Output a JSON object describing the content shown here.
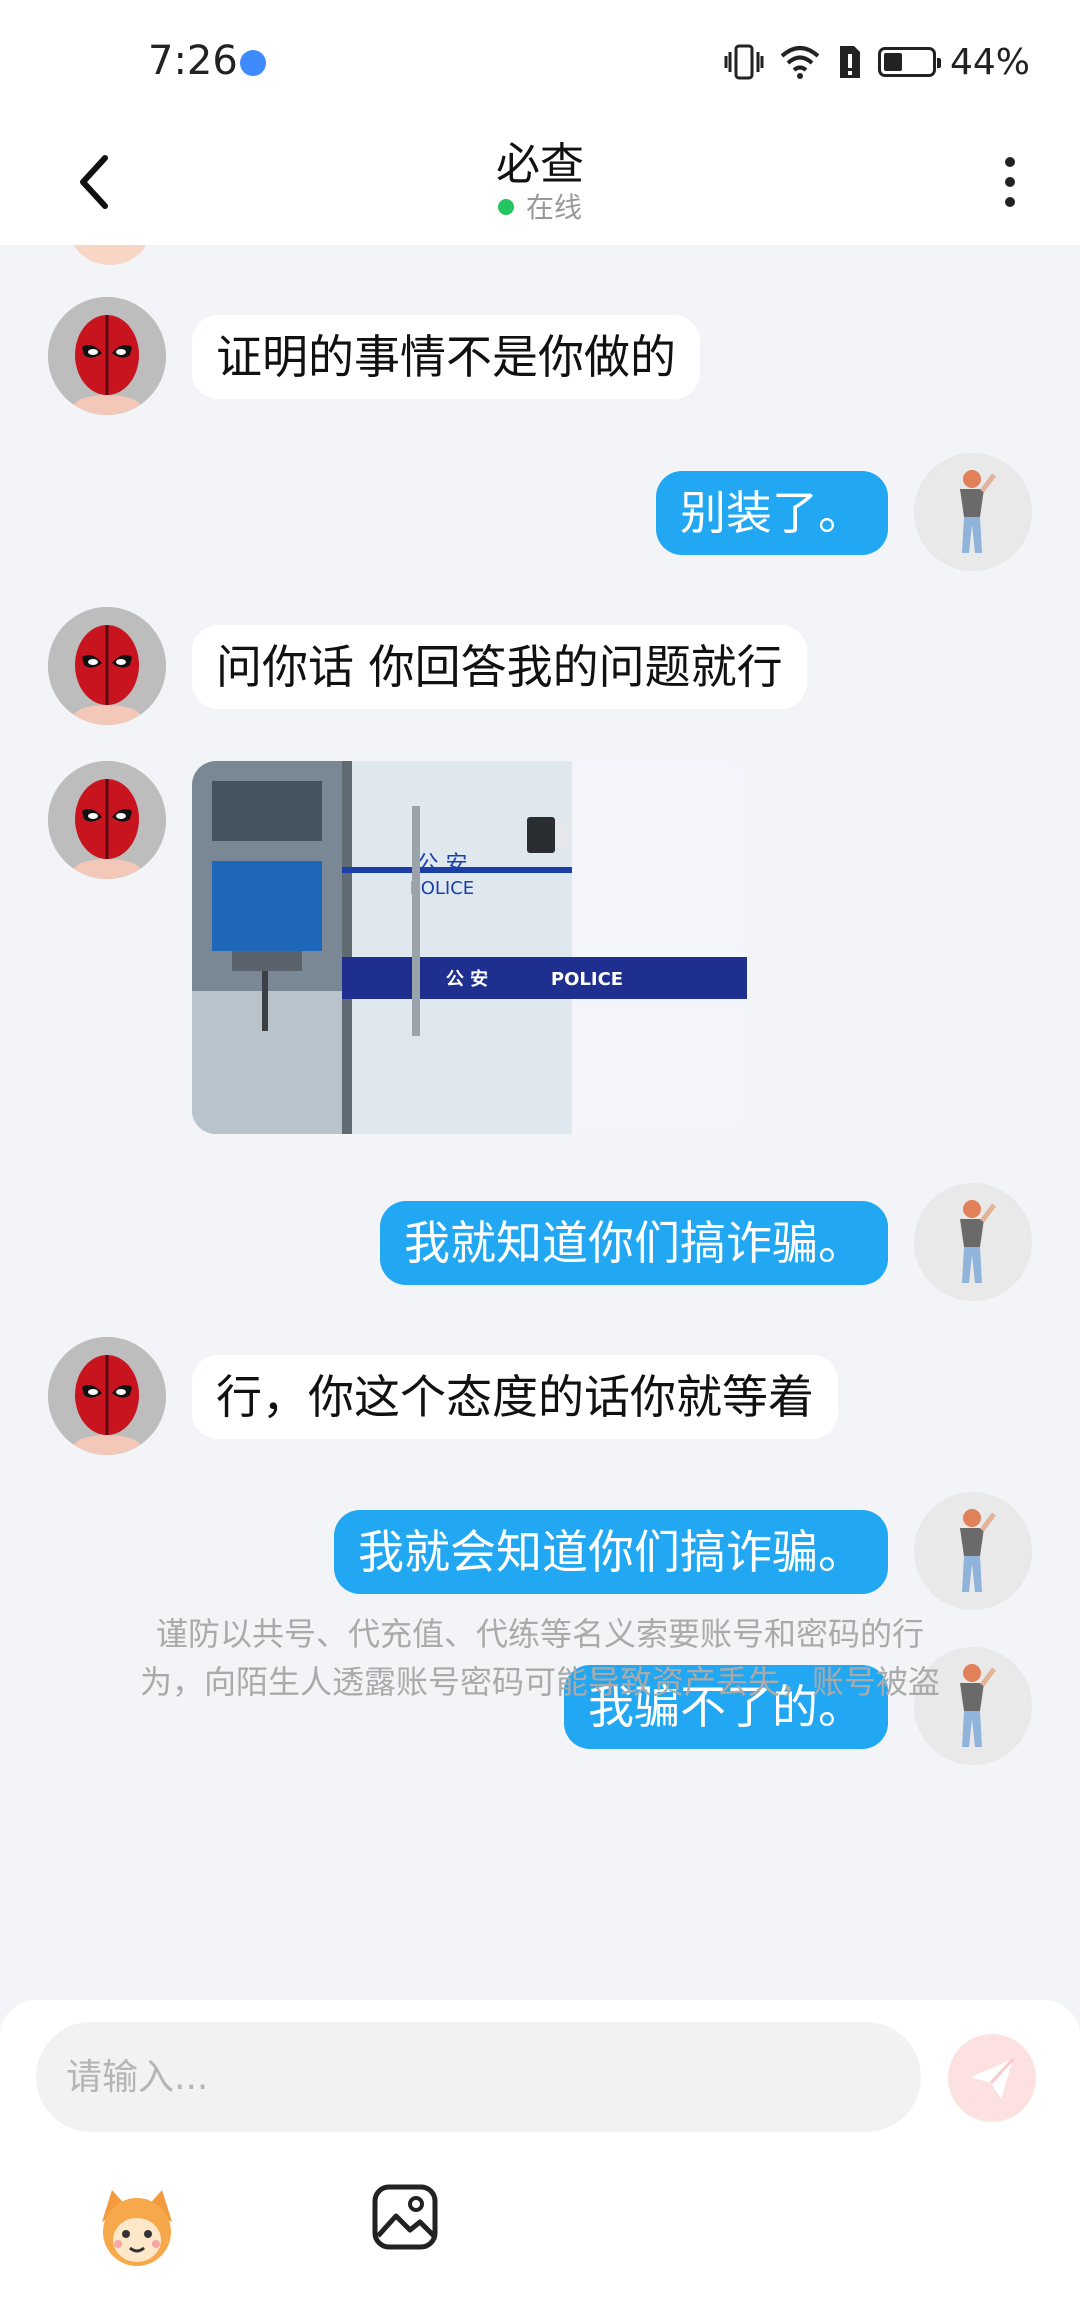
{
  "status_bar": {
    "time": "7:26",
    "battery": "44%"
  },
  "header": {
    "title": "必查",
    "status": "在线"
  },
  "messages": [
    {
      "text": "证明的事情不是你做的"
    },
    {
      "text": "别装了。"
    },
    {
      "text": "问你话 你回答我的问题就行"
    },
    {
      "image_text_1": "公 安",
      "image_text_2": "POLICE",
      "image_text_3": "公 安",
      "image_text_4": "POLICE"
    },
    {
      "text": "我就知道你们搞诈骗。"
    },
    {
      "text": "行，你这个态度的话你就等着"
    },
    {
      "text": "我就会知道你们搞诈骗。"
    },
    {
      "text": "我骗不了的。"
    }
  ],
  "notice": {
    "line1": "谨防以共号、代充值、代练等名义索要账号和密码的行",
    "line2": "为，向陌生人透露账号密码可能导致资产丢失，账号被盗"
  },
  "input": {
    "placeholder": "请输入..."
  },
  "colors": {
    "accent": "#22a7f2",
    "online": "#22c55e",
    "background": "#f2f4f7",
    "send_disabled": "#fde1e1"
  },
  "icons": {
    "back": "chevron-left-icon",
    "more": "more-vertical-icon",
    "send": "paper-plane-icon",
    "sticker": "mascot-sticker-icon",
    "gallery": "image-gallery-icon"
  }
}
